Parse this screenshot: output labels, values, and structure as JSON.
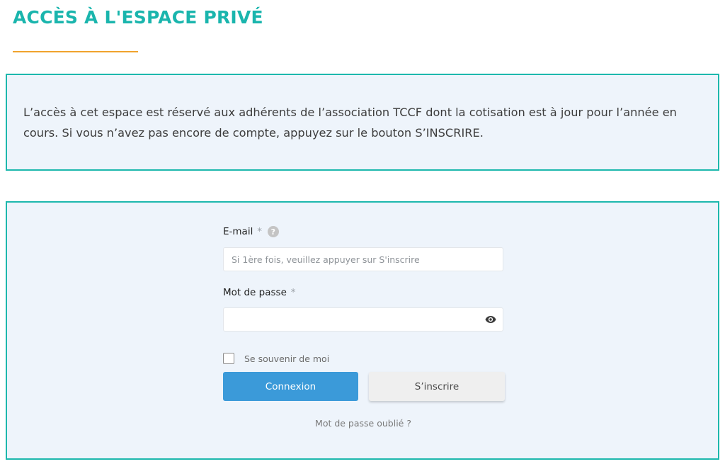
{
  "header": {
    "title": "ACCÈS À L'ESPACE PRIVÉ",
    "title_color": "#1ab5ad",
    "underline_color": "#f0a32e"
  },
  "notice": {
    "text": "L’accès à cet espace est réservé aux adhérents de l’association TCCF dont la cotisation est à jour pour l’année en cours. Si vous n’avez pas encore de compte, appuyez sur le bouton S’INSCRIRE.",
    "border_color": "#1db8ad",
    "background": "#eef4fb"
  },
  "form": {
    "email": {
      "label": "E-mail",
      "required_mark": "*",
      "help_icon": "question-circle-icon",
      "placeholder": "Si 1ère fois, veuillez appuyer sur S'inscrire",
      "value": ""
    },
    "password": {
      "label": "Mot de passe",
      "required_mark": "*",
      "value": "",
      "toggle_icon": "eye-icon"
    },
    "remember": {
      "label": "Se souvenir de moi",
      "checked": false
    },
    "login_button": "Connexion",
    "register_button": "S’inscrire",
    "forgot_link": "Mot de passe oublié ?",
    "login_button_color": "#3b9ad9"
  }
}
